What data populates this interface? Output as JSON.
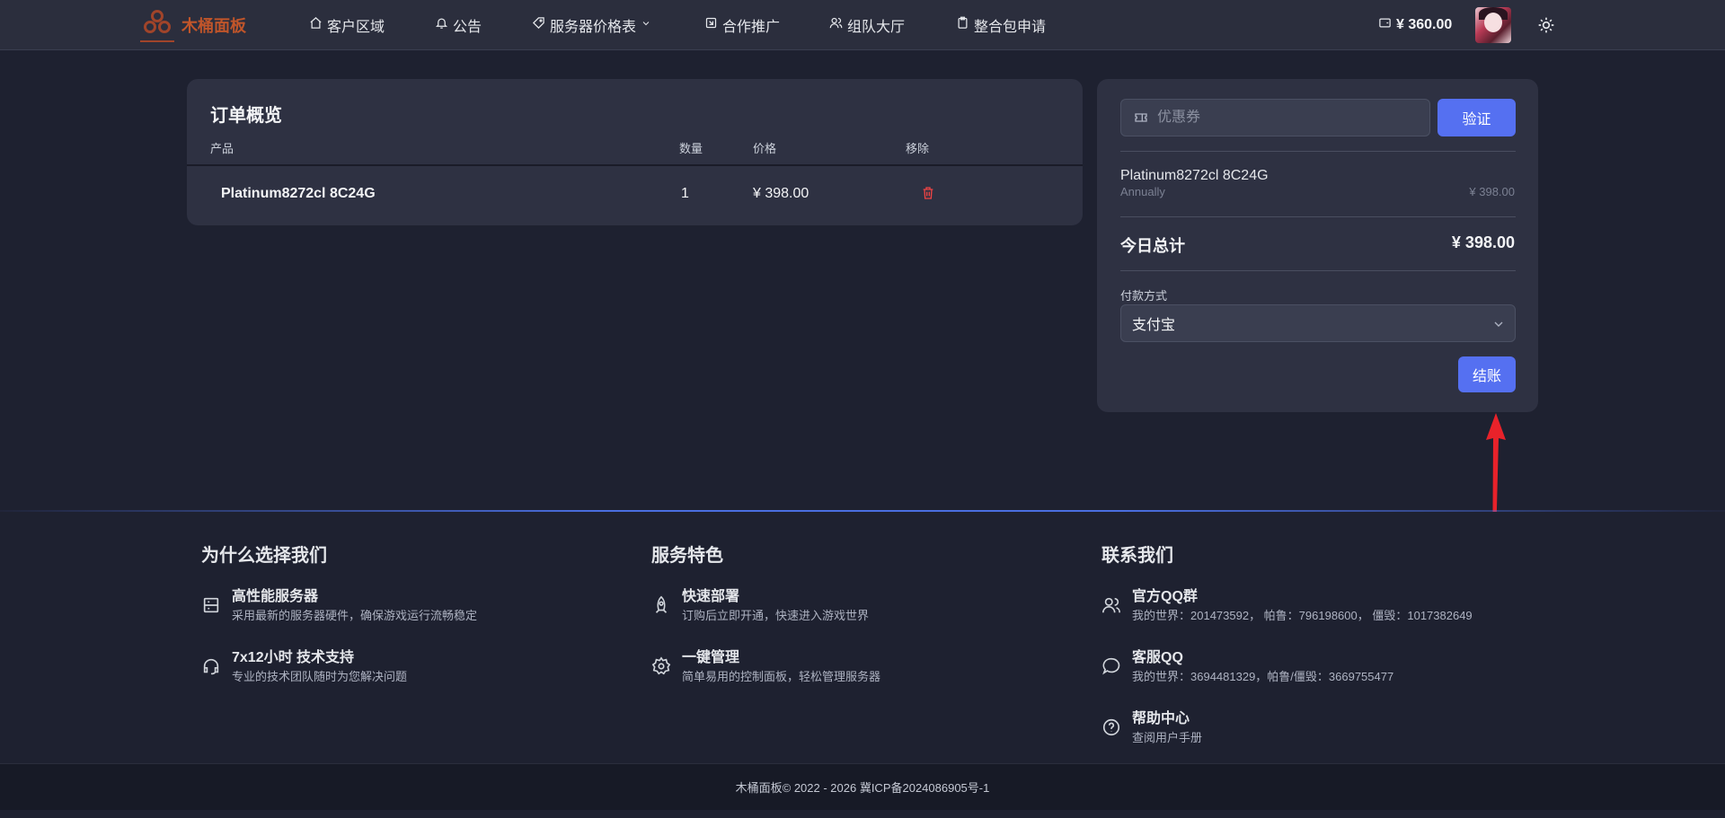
{
  "nav": {
    "brand_name": "木桶面板",
    "items": [
      {
        "label": "客户区域",
        "icon": "home-icon"
      },
      {
        "label": "公告",
        "icon": "bell-icon"
      },
      {
        "label": "服务器价格表",
        "icon": "tag-icon",
        "dropdown": true
      },
      {
        "label": "合作推广",
        "icon": "share-icon"
      },
      {
        "label": "组队大厅",
        "icon": "users-icon"
      },
      {
        "label": "整合包申请",
        "icon": "clipboard-icon"
      }
    ],
    "balance": "¥ 360.00"
  },
  "order": {
    "title": "订单概览",
    "headers": {
      "product": "产品",
      "qty": "数量",
      "price": "价格",
      "remove": "移除"
    },
    "rows": [
      {
        "product": "Platinum8272cl 8C24G",
        "qty": "1",
        "price": "¥ 398.00"
      }
    ]
  },
  "summary": {
    "coupon_placeholder": "优惠券",
    "verify_label": "验证",
    "item_name": "Platinum8272cl 8C24G",
    "item_cycle": "Annually",
    "item_price": "¥ 398.00",
    "total_label": "今日总计",
    "total_value": "¥ 398.00",
    "payment_label": "付款方式",
    "payment_selected": "支付宝",
    "checkout_label": "结账"
  },
  "annotation": {
    "color": "#e8222a"
  },
  "footer": {
    "col1": {
      "title": "为什么选择我们",
      "items": [
        {
          "head": "高性能服务器",
          "desc": "采用最新的服务器硬件，确保游戏运行流畅稳定",
          "icon": "server-icon"
        },
        {
          "head": "7x12小时 技术支持",
          "desc": "专业的技术团队随时为您解决问题",
          "icon": "headset-icon"
        }
      ]
    },
    "col2": {
      "title": "服务特色",
      "items": [
        {
          "head": "快速部署",
          "desc": "订购后立即开通，快速进入游戏世界",
          "icon": "rocket-icon"
        },
        {
          "head": "一键管理",
          "desc": "简单易用的控制面板，轻松管理服务器",
          "icon": "gear-icon"
        }
      ]
    },
    "col3": {
      "title": "联系我们",
      "items": [
        {
          "head": "官方QQ群",
          "desc": "我的世界：201473592， 帕鲁：796198600， 僵毁：1017382649",
          "icon": "group-icon"
        },
        {
          "head": "客服QQ",
          "desc": "我的世界：3694481329，帕鲁/僵毁：3669755477",
          "icon": "chat-icon"
        },
        {
          "head": "帮助中心",
          "desc": "查阅用户手册",
          "icon": "help-icon"
        }
      ]
    },
    "copyright": "木桶面板© 2022 - 2026 冀ICP备2024086905号-1"
  },
  "colors": {
    "accent": "#5570f1",
    "danger": "#ef4444",
    "brand": "#c0552a",
    "background": "#1e2130",
    "card": "#2e3142"
  }
}
